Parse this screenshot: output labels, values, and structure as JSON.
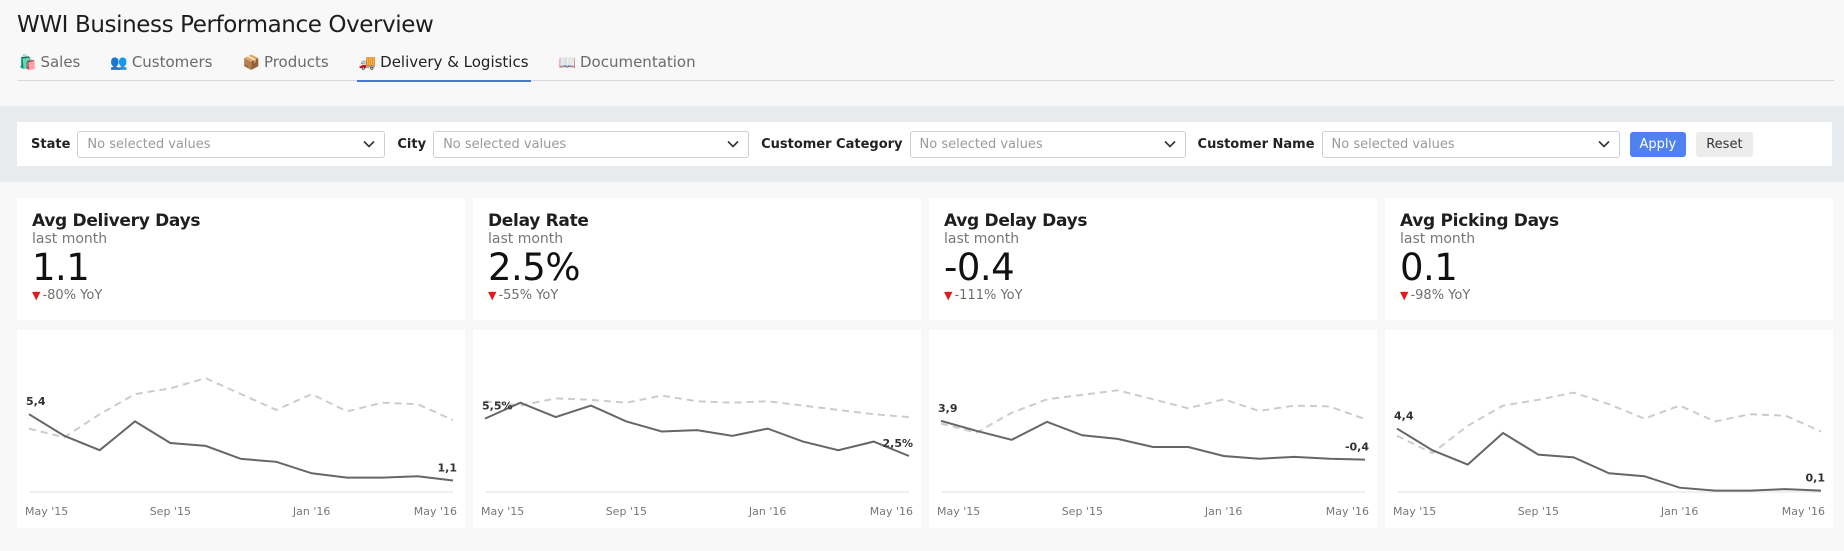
{
  "page": {
    "title": "WWI Business Performance Overview"
  },
  "tabs": [
    {
      "emoji": "🛍️",
      "label": "Sales",
      "active": false
    },
    {
      "emoji": "👥",
      "label": "Customers",
      "active": false
    },
    {
      "emoji": "📦",
      "label": "Products",
      "active": false
    },
    {
      "emoji": "🚚",
      "label": "Delivery & Logistics",
      "active": true
    },
    {
      "emoji": "📖",
      "label": "Documentation",
      "active": false
    }
  ],
  "filters": {
    "state": {
      "label": "State",
      "placeholder": "No selected values"
    },
    "city": {
      "label": "City",
      "placeholder": "No selected values"
    },
    "category": {
      "label": "Customer Category",
      "placeholder": "No selected values"
    },
    "customer": {
      "label": "Customer Name",
      "placeholder": "No selected values"
    },
    "apply_label": "Apply",
    "reset_label": "Reset"
  },
  "kpis": [
    {
      "title": "Avg Delivery Days",
      "period": "last month",
      "value": "1.1",
      "change": "-80% YoY"
    },
    {
      "title": "Delay Rate",
      "period": "last month",
      "value": "2.5%",
      "change": "-55% YoY"
    },
    {
      "title": "Avg Delay Days",
      "period": "last month",
      "value": "-0.4",
      "change": "-111% YoY"
    },
    {
      "title": "Avg Picking Days",
      "period": "last month",
      "value": "0.1",
      "change": "-98% YoY"
    }
  ],
  "colors": {
    "current_line": "#666666",
    "previous_line": "#cccccc",
    "down_indicator": "#e01b1b",
    "apply_button": "#4f82ee",
    "active_tab": "#4a77d6"
  },
  "chart_data": [
    {
      "type": "line",
      "x": [
        "May '15",
        "Jun '15",
        "Jul '15",
        "Aug '15",
        "Sep '15",
        "Oct '15",
        "Nov '15",
        "Dec '15",
        "Jan '16",
        "Feb '16",
        "Mar '16",
        "Apr '16",
        "May '16"
      ],
      "xticks": [
        "May '15",
        "Sep '15",
        "Jan '16",
        "May '16"
      ],
      "series": [
        {
          "values": [
            5.4,
            3.9,
            2.9,
            4.9,
            3.4,
            3.2,
            2.3,
            2.1,
            1.3,
            1.0,
            1.0,
            1.1,
            0.8
          ]
        },
        {
          "values": [
            4.4,
            3.8,
            5.4,
            6.8,
            7.2,
            7.9,
            6.8,
            5.7,
            6.8,
            5.6,
            6.2,
            6.1,
            5.0
          ]
        }
      ],
      "first_label": "5,4",
      "last_label": "1,1",
      "ylim": [
        0,
        10
      ]
    },
    {
      "type": "line",
      "x": [
        "May '15",
        "Jun '15",
        "Jul '15",
        "Aug '15",
        "Sep '15",
        "Oct '15",
        "Nov '15",
        "Dec '15",
        "Jan '16",
        "Feb '16",
        "Mar '16",
        "Apr '16",
        "May '16"
      ],
      "xticks": [
        "May '15",
        "Sep '15",
        "Jan '16",
        "May '16"
      ],
      "series": [
        {
          "values": [
            5.1,
            6.2,
            5.2,
            6.0,
            4.9,
            4.2,
            4.3,
            3.9,
            4.4,
            3.5,
            2.9,
            3.5,
            2.5
          ]
        },
        {
          "values": [
            6.3,
            6.0,
            6.5,
            6.4,
            6.2,
            6.7,
            6.3,
            6.2,
            6.3,
            6.0,
            5.7,
            5.4,
            5.2
          ]
        }
      ],
      "first_label": "5,5%",
      "last_label": "2,5%",
      "ylim": [
        0,
        10
      ]
    },
    {
      "type": "line",
      "x": [
        "May '15",
        "Jun '15",
        "Jul '15",
        "Aug '15",
        "Sep '15",
        "Oct '15",
        "Nov '15",
        "Dec '15",
        "Jan '16",
        "Feb '16",
        "Mar '16",
        "Apr '16",
        "May '16"
      ],
      "xticks": [
        "May '15",
        "Sep '15",
        "Jan '16",
        "May '16"
      ],
      "series": [
        {
          "values": [
            3.9,
            2.8,
            1.8,
            3.8,
            2.3,
            1.9,
            1.0,
            1.0,
            0.0,
            -0.3,
            -0.1,
            -0.3,
            -0.4
          ]
        },
        {
          "values": [
            3.6,
            2.6,
            4.8,
            6.3,
            6.8,
            7.3,
            6.3,
            5.3,
            6.3,
            5.0,
            5.6,
            5.5,
            4.1
          ]
        }
      ],
      "first_label": "3,9",
      "last_label": "-0,4",
      "ylim": [
        -4,
        12
      ]
    },
    {
      "type": "line",
      "x": [
        "May '15",
        "Jun '15",
        "Jul '15",
        "Aug '15",
        "Sep '15",
        "Oct '15",
        "Nov '15",
        "Dec '15",
        "Jan '16",
        "Feb '16",
        "Mar '16",
        "Apr '16",
        "May '16"
      ],
      "xticks": [
        "May '15",
        "Sep '15",
        "Jan '16",
        "May '16"
      ],
      "series": [
        {
          "values": [
            4.4,
            2.9,
            1.9,
            4.1,
            2.6,
            2.4,
            1.3,
            1.1,
            0.3,
            0.1,
            0.1,
            0.2,
            0.1
          ]
        },
        {
          "values": [
            3.9,
            2.7,
            4.6,
            6.0,
            6.4,
            6.9,
            6.1,
            5.1,
            6.0,
            4.9,
            5.4,
            5.3,
            4.2
          ]
        }
      ],
      "first_label": "4,4",
      "last_label": "0,1",
      "ylim": [
        0,
        10
      ]
    }
  ]
}
